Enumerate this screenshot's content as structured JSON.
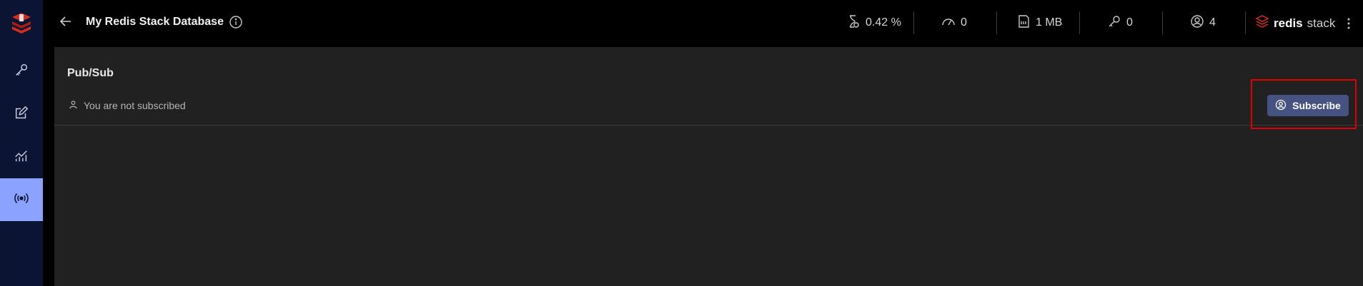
{
  "header": {
    "db_title": "My Redis Stack Database",
    "stats": {
      "cpu": "0.42 %",
      "ops": "0",
      "memory": "1 MB",
      "keys": "0",
      "clients": "4"
    },
    "brand": {
      "name": "redis",
      "suffix": "stack"
    }
  },
  "sidebar": {
    "items": [
      {
        "icon": "key-icon"
      },
      {
        "icon": "edit-icon"
      },
      {
        "icon": "analytics-icon"
      },
      {
        "icon": "pubsub-icon",
        "active": true
      }
    ]
  },
  "main": {
    "title": "Pub/Sub",
    "status_text": "You are not subscribed",
    "subscribe_label": "Subscribe"
  },
  "colors": {
    "sidebar_bg": "#0b1433",
    "sidebar_active": "#8ba2ff",
    "panel_bg": "#212121",
    "button_bg": "#465282",
    "highlight": "#e10000"
  }
}
